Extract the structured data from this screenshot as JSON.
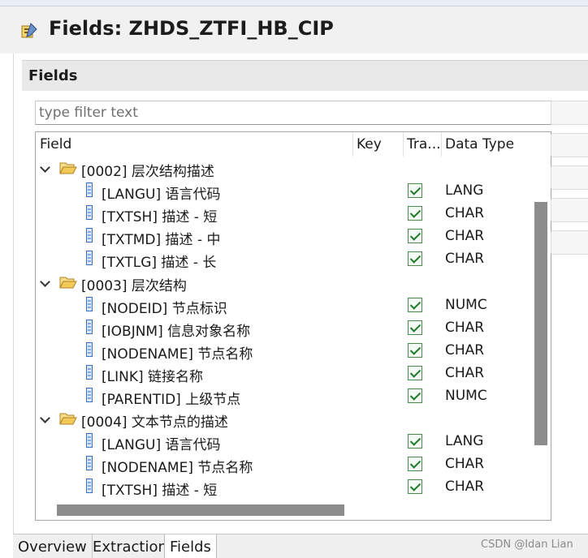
{
  "window": {
    "title": "Fields: ZHDS_ZTFI_HB_CIP",
    "top_tabs": []
  },
  "section": {
    "title": "Fields"
  },
  "filter": {
    "placeholder": "type filter text",
    "value": ""
  },
  "columns": [
    "Field",
    "Key",
    "Tra...",
    "Data Type"
  ],
  "tree": [
    {
      "label": "[0002] 层次结构描述",
      "expanded": true,
      "children": [
        {
          "label": "[LANGU] 语言代码",
          "key": false,
          "transfer": true,
          "data_type": "LANG"
        },
        {
          "label": "[TXTSH] 描述 - 短",
          "key": false,
          "transfer": true,
          "data_type": "CHAR"
        },
        {
          "label": "[TXTMD] 描述 - 中",
          "key": false,
          "transfer": true,
          "data_type": "CHAR"
        },
        {
          "label": "[TXTLG] 描述 - 长",
          "key": false,
          "transfer": true,
          "data_type": "CHAR"
        }
      ]
    },
    {
      "label": "[0003] 层次结构",
      "expanded": true,
      "children": [
        {
          "label": "[NODEID] 节点标识",
          "key": false,
          "transfer": true,
          "data_type": "NUMC"
        },
        {
          "label": "[IOBJNM] 信息对象名称",
          "key": false,
          "transfer": true,
          "data_type": "CHAR"
        },
        {
          "label": "[NODENAME] 节点名称",
          "key": false,
          "transfer": true,
          "data_type": "CHAR"
        },
        {
          "label": "[LINK] 链接名称",
          "key": false,
          "transfer": true,
          "data_type": "CHAR"
        },
        {
          "label": "[PARENTID] 上级节点",
          "key": false,
          "transfer": true,
          "data_type": "NUMC"
        }
      ]
    },
    {
      "label": "[0004] 文本节点的描述",
      "expanded": true,
      "children": [
        {
          "label": "[LANGU] 语言代码",
          "key": false,
          "transfer": true,
          "data_type": "LANG"
        },
        {
          "label": "[NODENAME] 节点名称",
          "key": false,
          "transfer": true,
          "data_type": "CHAR"
        },
        {
          "label": "[TXTSH] 描述 - 短",
          "key": false,
          "transfer": true,
          "data_type": "CHAR"
        }
      ]
    }
  ],
  "bottom_tabs": [
    {
      "label": "Overview",
      "active": false
    },
    {
      "label": "Extraction",
      "active": false
    },
    {
      "label": "Fields",
      "active": true
    }
  ],
  "watermark": "CSDN @Idan Lian",
  "icons": {
    "title": "datasource-edit-icon",
    "group": "folder-open-icon",
    "field": "field-icon",
    "expand": "chevron-down-icon",
    "checkbox": "checkbox-checked-icon"
  },
  "colors": {
    "folder": "#e8b64c",
    "field_icon": "#3a6fc0",
    "checkbox_check": "#1e7a2a",
    "scroll_thumb": "#8c8c8c"
  }
}
